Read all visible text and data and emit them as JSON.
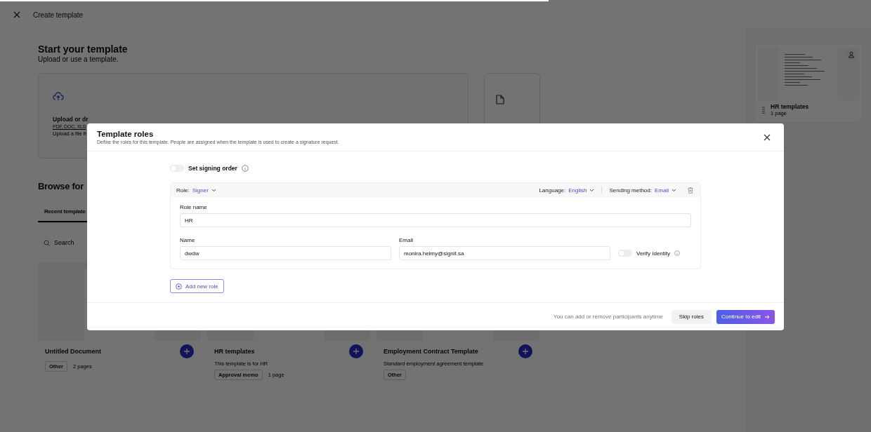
{
  "progress": {
    "level": 0.63
  },
  "header": {
    "title": "Create template"
  },
  "start": {
    "title": "Start your template",
    "subtitle": "Upload or use a template.",
    "upload": {
      "title": "Upload or dr",
      "formats": "PDF, DOC, XLS",
      "hint": "Upload a file fr"
    }
  },
  "browse": {
    "title": "Browse for",
    "tabs": [
      {
        "label": "Recent template",
        "selected": true
      }
    ],
    "search": {
      "placeholder": "Search"
    },
    "templates": [
      {
        "title": "Untitled Document",
        "tags": [
          "Other"
        ],
        "pages": "2 pages"
      },
      {
        "title": "HR templates",
        "description": "This template is for HR",
        "tags": [
          "Approval memo"
        ],
        "pages": "1 page"
      },
      {
        "title": "Employment Contract Template",
        "description": "Standard employment agreement template",
        "tags": [
          "Other"
        ]
      }
    ]
  },
  "side_panel": {
    "title": "HR templates",
    "pages": "1 page"
  },
  "modal": {
    "title": "Template roles",
    "description": "Define the roles for this template. People are assigned when the template is used to create a signature request.",
    "signing_order": {
      "label": "Set signing order",
      "on": false
    },
    "roles": [
      {
        "role_label": "Role:",
        "role": "Signer",
        "language_label": "Language:",
        "language": "English",
        "sending_label": "Sending method:",
        "sending": "Email",
        "role_name_label": "Role name",
        "role_name": "HR",
        "name_label": "Name",
        "name": "dwdw",
        "email_label": "Email",
        "email": "monira.helmy@signit.sa",
        "verify": {
          "label": "Verify Identity",
          "on": false
        }
      }
    ],
    "add_role": "Add new role",
    "footer_note": "You can add or remove participants anytime",
    "skip": "Skip roles",
    "continue": "Continue to edit"
  }
}
